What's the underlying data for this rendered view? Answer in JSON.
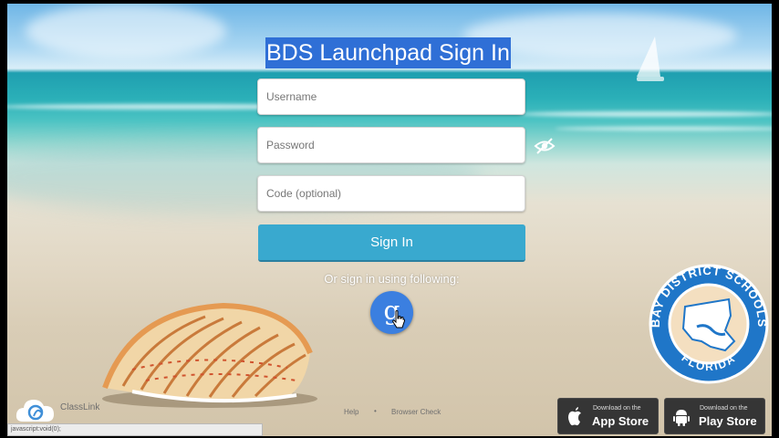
{
  "page": {
    "title": "BDS Launchpad Sign In"
  },
  "form": {
    "username_placeholder": "Username",
    "password_placeholder": "Password",
    "code_placeholder": "Code (optional)",
    "signin_label": "Sign In",
    "alt_signin_text": "Or sign in using following:",
    "google_glyph": "g"
  },
  "seal": {
    "top_text": "BAY DISTRICT SCHOOLS",
    "bottom_text": "FLORIDA"
  },
  "footer": {
    "classlink_label": "ClassLink",
    "help_label": "Help",
    "separator": "•",
    "browser_check_label": "Browser Check",
    "status_text": "javascript:void(0);"
  },
  "stores": {
    "app_store_small": "Download on the",
    "app_store_big": "App Store",
    "play_store_small": "Download on the",
    "play_store_big": "Play Store"
  },
  "colors": {
    "title_highlight": "#2f6fd6",
    "signin_button": "#39a9cf",
    "google_button": "#3b7fe0",
    "seal_blue": "#1f76c8"
  },
  "icons": [
    "eye-slash-icon",
    "google-icon",
    "classlink-logo-icon",
    "apple-icon",
    "android-icon",
    "hand-cursor-icon"
  ]
}
